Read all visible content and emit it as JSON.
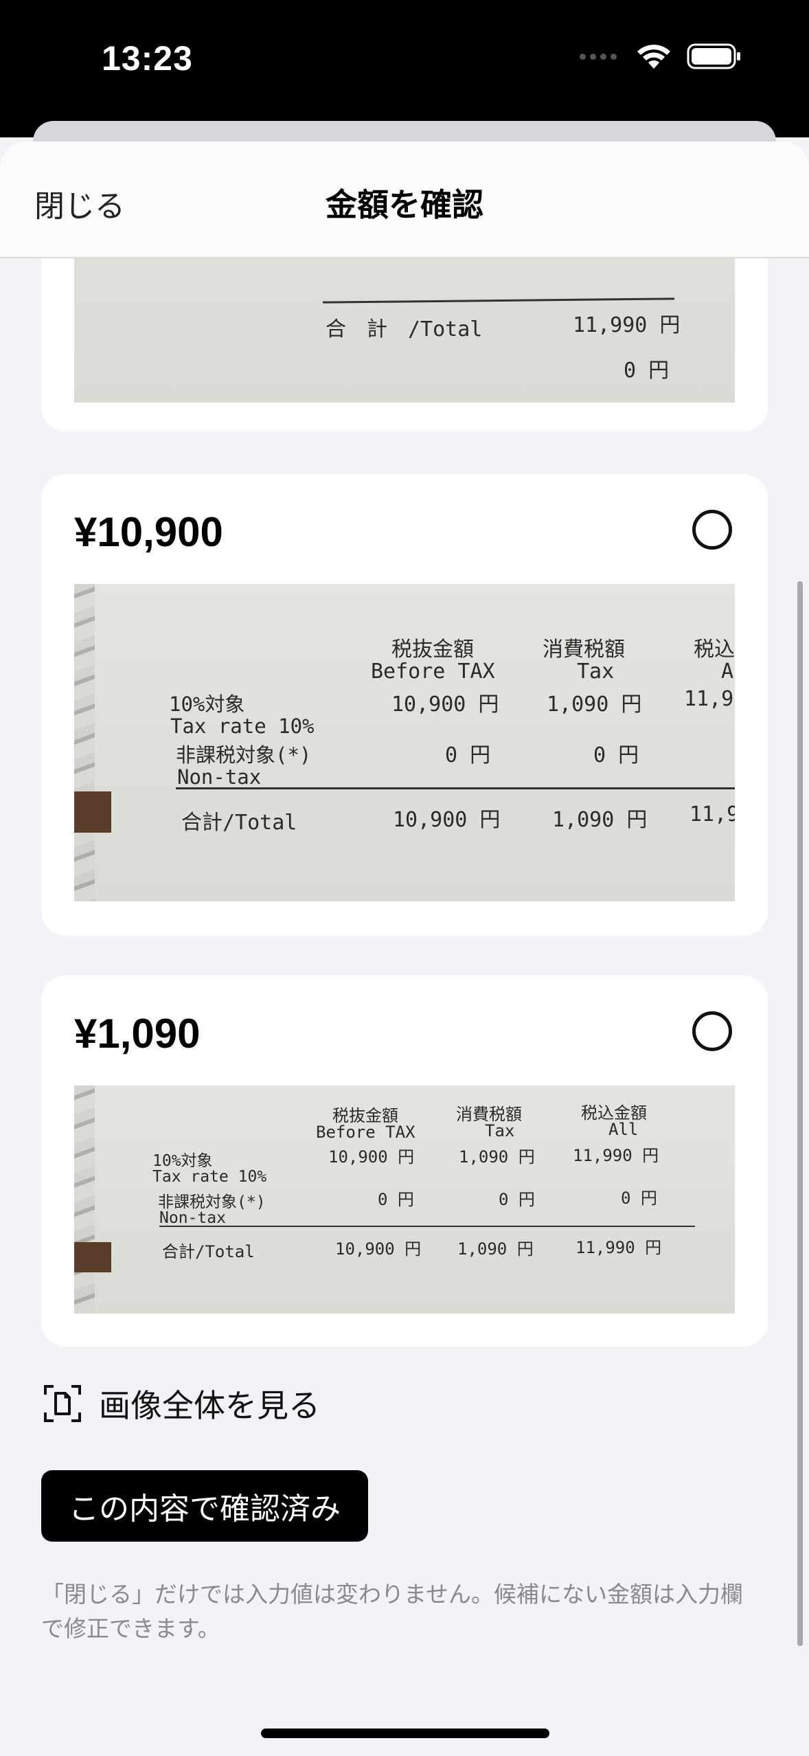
{
  "status_bar": {
    "time": "13:23",
    "icons": [
      "signal-dots",
      "wifi-icon",
      "battery-icon"
    ]
  },
  "nav": {
    "close_label": "閉じる",
    "title": "金額を確認"
  },
  "top_card": {
    "receipt": {
      "total_label": "合　計　/Total",
      "total_value": "11,990 円",
      "zero_value": "0 円"
    }
  },
  "cards": [
    {
      "amount": "¥10,900",
      "selected": false,
      "receipt": {
        "col1_jp": "税抜金額",
        "col1_en": "Before TAX",
        "col2_jp": "消費税額",
        "col2_en": "Tax",
        "col3_jp": "税込",
        "col3_en": "A",
        "row1_jp": "10%対象",
        "row1_en": "Tax rate 10%",
        "row1_v1": "10,900 円",
        "row1_v2": "1,090 円",
        "row1_v3": "11,99",
        "row2_jp": "非課税対象(*)",
        "row2_en": "Non-tax",
        "row2_v1": "0 円",
        "row2_v2": "0 円",
        "total_label": "合計/Total",
        "total_v1": "10,900 円",
        "total_v2": "1,090 円",
        "total_v3": "11,9"
      }
    },
    {
      "amount": "¥1,090",
      "selected": false,
      "receipt": {
        "col1_jp": "税抜金額",
        "col1_en": "Before TAX",
        "col2_jp": "消費税額",
        "col2_en": "Tax",
        "col3_jp": "税込金額",
        "col3_en": "All",
        "row1_jp": "10%対象",
        "row1_en": "Tax rate 10%",
        "row1_v1": "10,900 円",
        "row1_v2": "1,090 円",
        "row1_v3": "11,990 円",
        "row2_jp": "非課税対象(*)",
        "row2_en": "Non-tax",
        "row2_v1": "0 円",
        "row2_v2": "0 円",
        "row2_v3": "0 円",
        "total_label": "合計/Total",
        "total_v1": "10,900 円",
        "total_v2": "1,090 円",
        "total_v3": "11,990 円"
      }
    }
  ],
  "view_all_label": "画像全体を見る",
  "confirm_button": "この内容で確認済み",
  "footnote": "「閉じる」だけでは入力値は変わりません。候補にない金額は入力欄で修正できます。",
  "colors": {
    "background": "#f2f2f7",
    "card": "#ffffff",
    "button": "#000000",
    "footnote": "#8a8a8e"
  }
}
